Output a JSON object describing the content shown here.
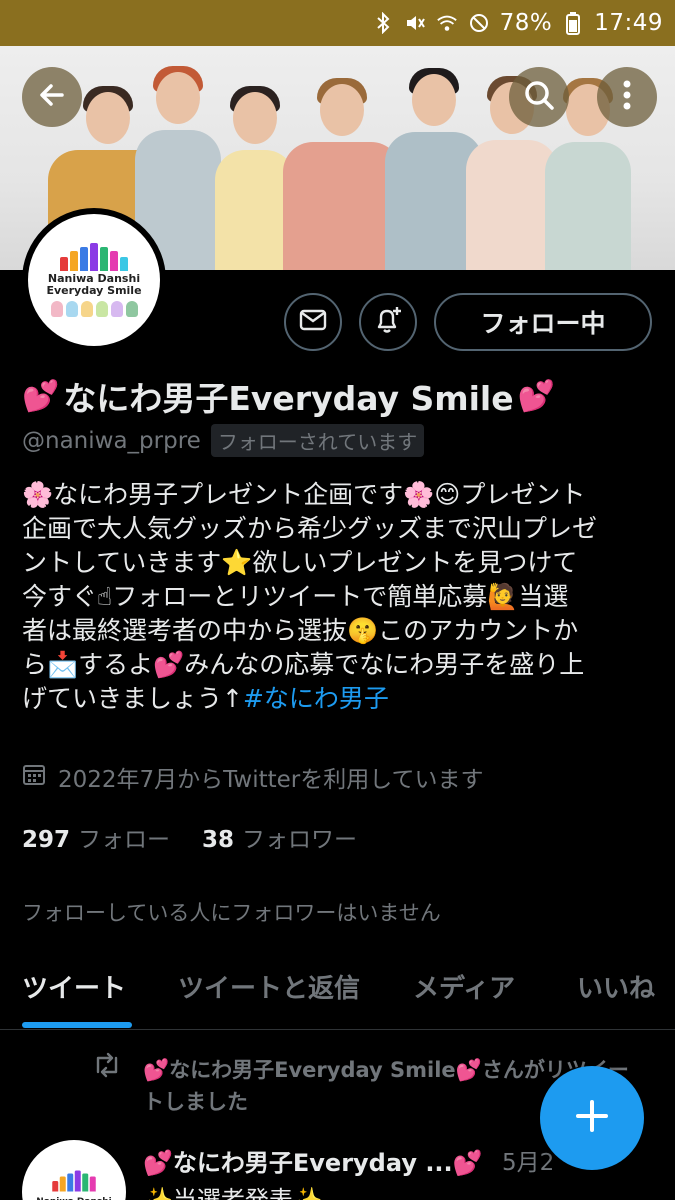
{
  "status_bar": {
    "battery": "78%",
    "time": "17:49"
  },
  "profile": {
    "name_text": "なにわ男子Everyday Smile",
    "handle": "@naniwa_prpre",
    "followed_badge": "フォローされています",
    "follow_button_label": "フォロー中",
    "avatar_logo_line1": "Naniwa Danshi",
    "avatar_logo_line2": "Everyday Smile",
    "bio_lines": [
      "🌸なにわ男子プレゼント企画です🌸😊プレゼント",
      "企画で大人気グッズから希少グッズまで沢山プレゼ",
      "ントしていきます⭐欲しいプレゼントを見つけて",
      "今すぐ☝フォローとリツイートで簡単応募🙋当選",
      "者は最終選考者の中から選抜🤫このアカウントか",
      "ら📩するよ💕みんなの応募でなにわ男子を盛り上"
    ],
    "bio_last_line_text": "げていきましょう↑",
    "bio_hashtag": "#なにわ男子",
    "joined": "2022年7月からTwitterを利用しています",
    "following_count": "297",
    "following_label": "フォロー",
    "followers_count": "38",
    "followers_label": "フォロワー",
    "no_known_followers": "フォローしている人にフォロワーはいません"
  },
  "tabs": [
    {
      "label": "ツイート",
      "active": true
    },
    {
      "label": "ツイートと返信",
      "active": false
    },
    {
      "label": "メディア",
      "active": false
    },
    {
      "label": "いいね",
      "active": false
    }
  ],
  "retweet_notice": {
    "line1": "💕なにわ男子Everyday Smile💕さんがリツイー",
    "line2": "トしました"
  },
  "tweet": {
    "author": "💕なにわ男子Everyday ...💕",
    "date": "5月2",
    "body": "✨当選者発表✨"
  },
  "icons": {
    "back": "arrow-left-icon",
    "search": "search-icon",
    "more": "more-vertical-icon",
    "message": "envelope-icon",
    "notify": "bell-plus-icon",
    "calendar": "calendar-icon",
    "retweet": "retweet-icon",
    "compose": "plus-icon"
  },
  "colors": {
    "accent": "#1d9bf0",
    "statusbar": "#8a6f1f",
    "heart": "#e0245e"
  }
}
